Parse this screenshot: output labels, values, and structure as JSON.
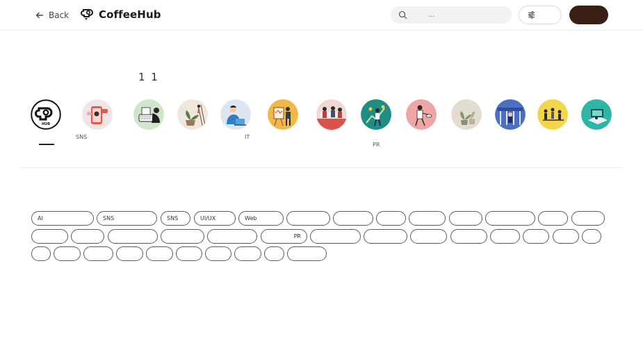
{
  "header": {
    "back_label": "Back",
    "brand_name": "CoffeeHub",
    "search_placeholder": "...",
    "filter_label": "",
    "primary_label": ""
  },
  "section": {
    "title": "1 1"
  },
  "categories": [
    {
      "label": "",
      "icon": "coffeehub-logo-icon",
      "active": true
    },
    {
      "label": "SNS",
      "icon": "phone-social-illustration-icon"
    },
    {
      "label": "",
      "icon": "typewriter-illustration-icon"
    },
    {
      "label": "",
      "icon": "plant-ladder-illustration-icon"
    },
    {
      "label": "IT",
      "icon": "developer-laptop-illustration-icon"
    },
    {
      "label": "",
      "icon": "painter-easel-illustration-icon"
    },
    {
      "label": "",
      "icon": "team-meeting-illustration-icon"
    },
    {
      "label": "PR",
      "icon": "marketing-growth-illustration-icon"
    },
    {
      "label": "",
      "icon": "chef-cooking-illustration-icon"
    },
    {
      "label": "",
      "icon": "plants-illustration-icon"
    },
    {
      "label": "",
      "icon": "storefront-illustration-icon"
    },
    {
      "label": "",
      "icon": "people-chairs-illustration-icon"
    },
    {
      "label": "",
      "icon": "online-laptop-illustration-icon"
    }
  ],
  "tags": [
    "AI",
    "SNS",
    "SNS",
    "UI/UX",
    "Web",
    "",
    "",
    "",
    "",
    "",
    "",
    "",
    "",
    "",
    "",
    "",
    "",
    "",
    "PR",
    "",
    "",
    "",
    "",
    "",
    "",
    "",
    "",
    "",
    "",
    "",
    "",
    "",
    "",
    "",
    "",
    "",
    "",
    ""
  ],
  "colors": {
    "primary": "#3a1f17",
    "border": "#5a5a5a",
    "search_bg": "#f1f2f4"
  }
}
